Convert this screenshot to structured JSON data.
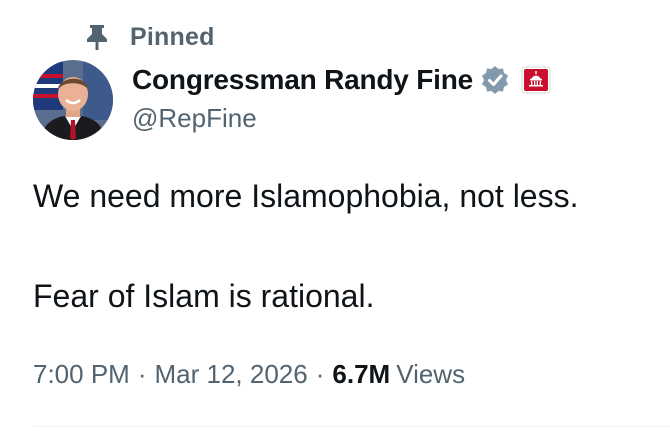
{
  "pinned": {
    "label": "Pinned",
    "icon": "pin-icon"
  },
  "author": {
    "display_name": "Congressman Randy Fine",
    "handle": "@RepFine",
    "verified_icon": "verified-badge-icon",
    "verified_color": "#829aab",
    "affiliation_icon": "government-badge-icon",
    "affiliation_color": "#c8102e"
  },
  "tweet": {
    "lines": [
      "We need more Islamophobia, not less.",
      "Fear of Islam is rational."
    ]
  },
  "meta": {
    "time": "7:00 PM",
    "separator": "·",
    "date": "Mar 12, 2026",
    "views_count": "6.7M",
    "views_label": "Views"
  },
  "colors": {
    "text_primary": "#0f1419",
    "text_secondary": "#536471"
  }
}
